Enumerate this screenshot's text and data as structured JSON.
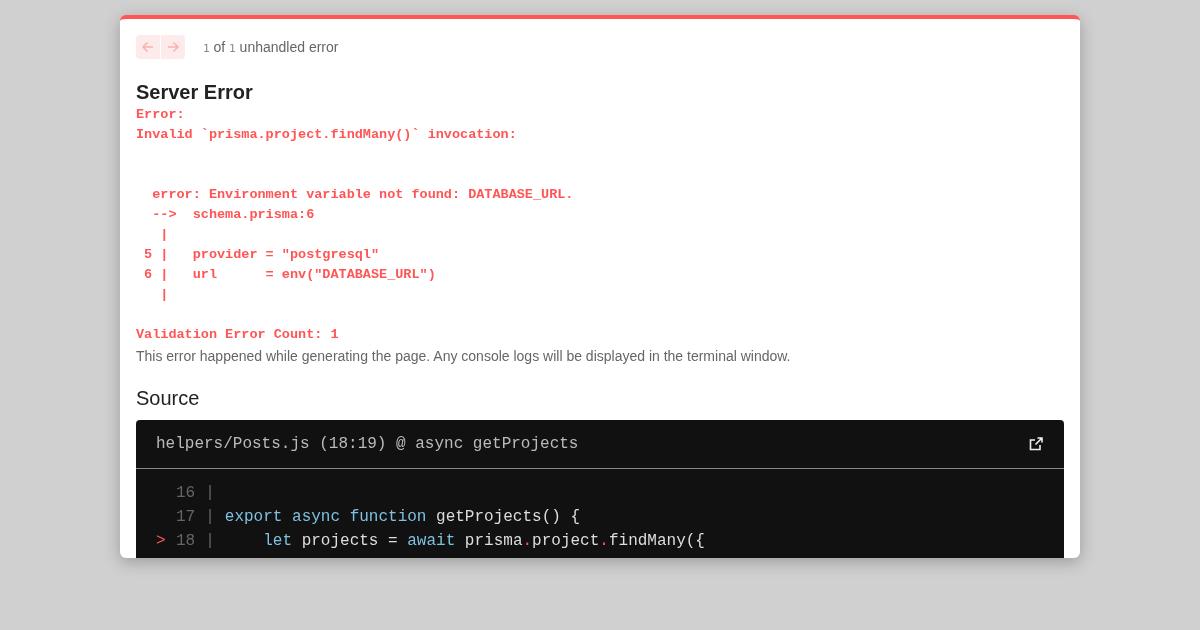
{
  "nav": {
    "previous_disabled": true,
    "next_disabled": true,
    "counter": {
      "current": "1",
      "of": "of",
      "total": "1",
      "label": "unhandled error"
    }
  },
  "title": "Server Error",
  "error_message": "Error: \nInvalid `prisma.project.findMany()` invocation:\n\n\n  error: Environment variable not found: DATABASE_URL.\n  -->  schema.prisma:6\n   | \n 5 |   provider = \"postgresql\"\n 6 |   url      = env(\"DATABASE_URL\")\n   | \n\nValidation Error Count: 1",
  "note": "This error happened while generating the page. Any console logs will be displayed in the terminal window.",
  "source": {
    "heading": "Source",
    "file": "helpers/Posts.js (18:19) @ async getProjects",
    "lines": [
      {
        "number": "16",
        "separator": "|"
      },
      {
        "number": "17",
        "separator": "|",
        "tokens": [
          {
            "kind": "keyword",
            "text": "export"
          },
          {
            "kind": "keyword",
            "text": " async"
          },
          {
            "kind": "keyword",
            "text": " function"
          },
          {
            "kind": "plain",
            "text": " getProjects() {"
          }
        ]
      },
      {
        "number": "18",
        "marker": ">",
        "separator": "|",
        "tokens": [
          {
            "kind": "keyword",
            "text": "    let"
          },
          {
            "kind": "plain",
            "text": " projects = "
          },
          {
            "kind": "keyword",
            "text": "await"
          },
          {
            "kind": "plain",
            "text": " prisma"
          },
          {
            "kind": "punct",
            "text": "."
          },
          {
            "kind": "plain",
            "text": "project"
          },
          {
            "kind": "punct",
            "text": "."
          },
          {
            "kind": "plain",
            "text": "findMany({"
          }
        ]
      }
    ]
  }
}
